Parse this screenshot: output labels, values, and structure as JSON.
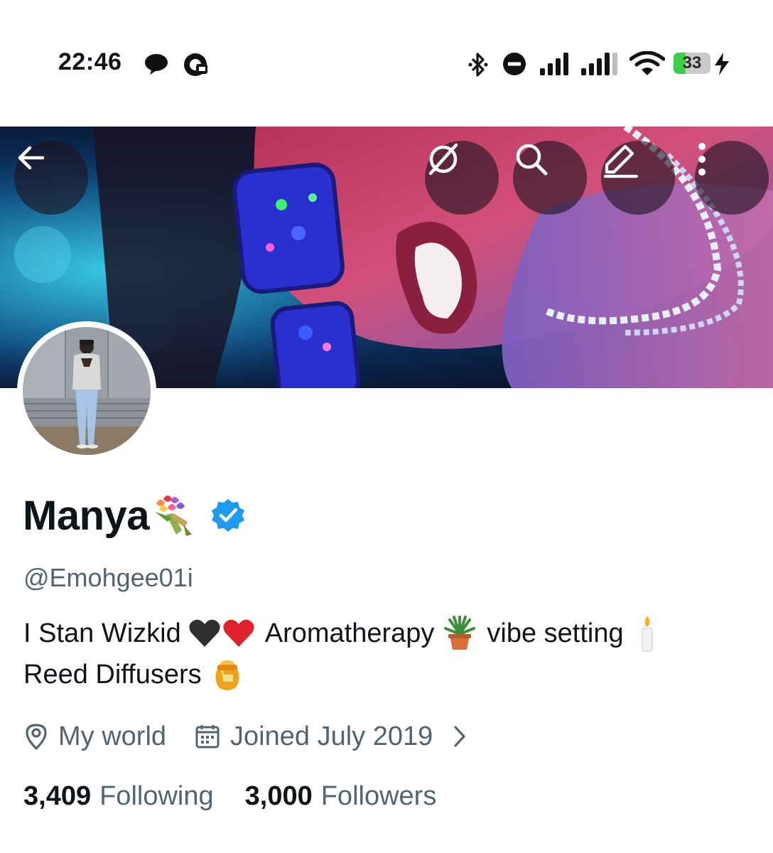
{
  "status_bar": {
    "time": "22:46",
    "battery": "33",
    "battery_level": 0.33,
    "icons": [
      "chat-bubble-icon",
      "notification-app-icon",
      "bluetooth-icon",
      "do-not-disturb-icon",
      "signal-icon",
      "signal-icon",
      "wifi-icon",
      "battery-icon",
      "charging-icon"
    ]
  },
  "header": {
    "buttons": [
      "back-icon",
      "vpn-icon",
      "search-icon",
      "edit-icon",
      "more-icon"
    ]
  },
  "profile": {
    "display_name": "Manya",
    "name_emoji": "bouquet-icon",
    "verified_color": "#1d9bf0",
    "handle": "@Emohgee01i",
    "bio_line1": {
      "part1": "I Stan Wizkid",
      "part2": "Aromatherapy",
      "part3": "vibe setting"
    },
    "bio_line2": {
      "part1": "Reed Diffusers"
    },
    "bio_emojis": [
      "black-heart-icon",
      "red-heart-icon",
      "potted-plant-icon",
      "candle-icon",
      "honey-pot-icon"
    ],
    "location": "My world",
    "joined": "Joined July 2019",
    "following_count": "3,409",
    "following_label": "Following",
    "followers_count": "3,000",
    "followers_label": "Followers"
  },
  "colors": {
    "text_primary": "#0f1419",
    "text_secondary": "#536471",
    "accent": "#1d9bf0",
    "battery_green": "#3bcf48"
  }
}
